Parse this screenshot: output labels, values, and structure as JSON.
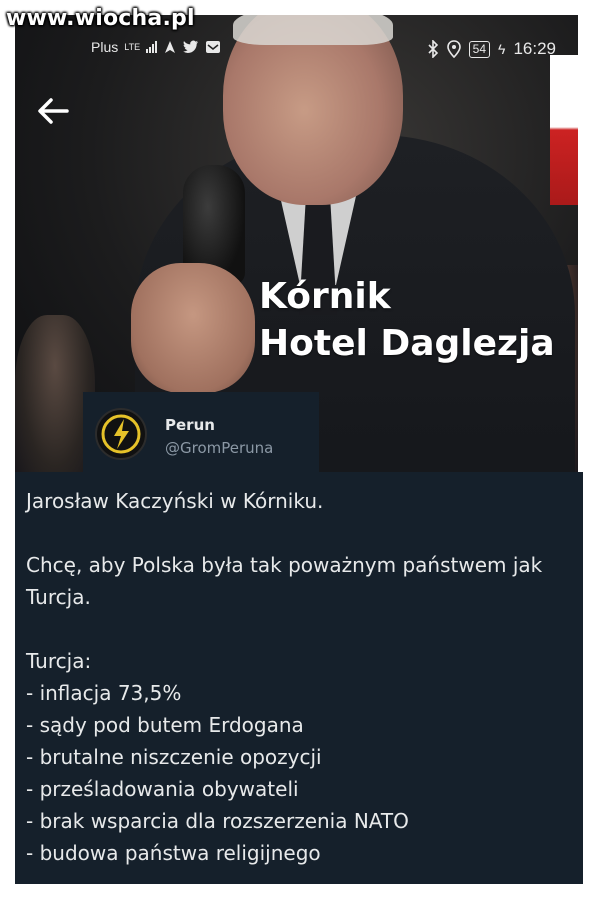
{
  "watermark": "www.wiocha.pl",
  "status_bar": {
    "carrier": "Plus",
    "network": "LTE",
    "battery": "54",
    "time": "16:29"
  },
  "photo": {
    "caption_line1": "Kórnik",
    "caption_line2": "Hotel Daglezja"
  },
  "author": {
    "name": "Perun",
    "handle": "@GromPeruna",
    "avatar_icon": "lightning-bolt-icon",
    "avatar_color": "#e6c229"
  },
  "tweet": {
    "line1": "Jarosław Kaczyński w Kórniku.",
    "line2": "Chcę, aby Polska była tak poważnym państwem jak Turcja.",
    "list_title": "Turcja:",
    "items": [
      "- inflacja 73,5%",
      "- sądy pod butem Erdogana",
      "- brutalne niszczenie opozycji",
      "- prześladowania obywateli",
      "- brak wsparcia dla rozszerzenia NATO",
      "- budowa państwa religijnego"
    ]
  },
  "colors": {
    "tweet_background": "#15202b",
    "tweet_text": "#e7e9ea",
    "handle_text": "#8b98a5"
  }
}
